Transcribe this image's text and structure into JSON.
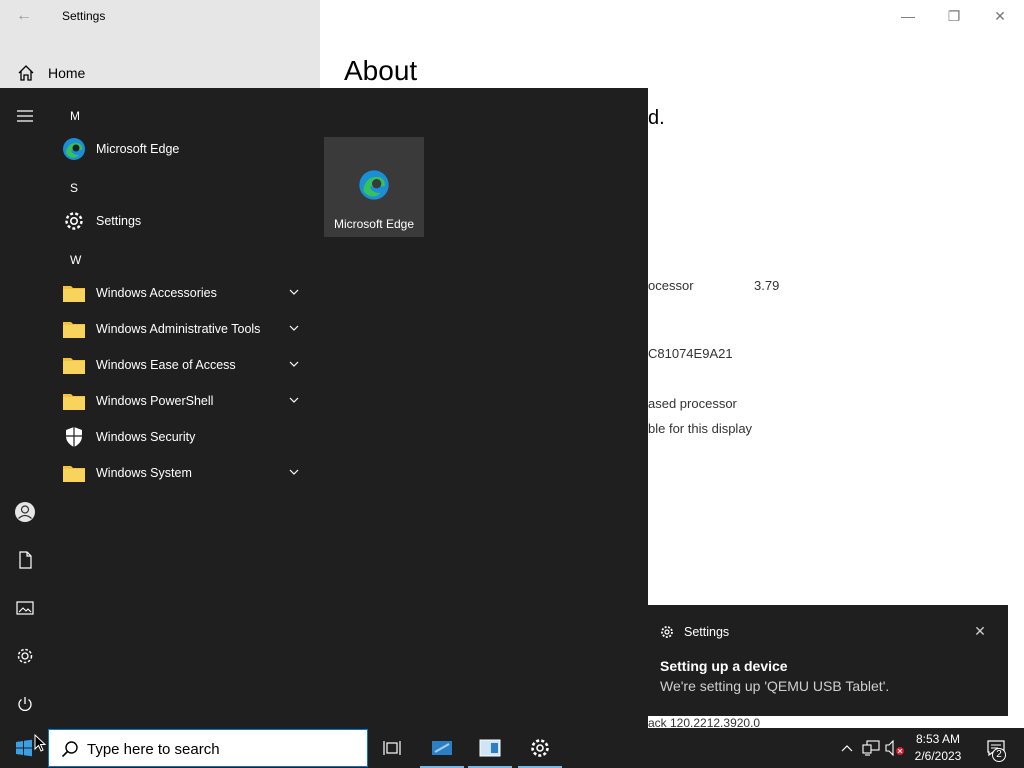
{
  "window": {
    "title": "Settings",
    "back_icon": "back-arrow-icon",
    "controls": [
      "minimize",
      "restore",
      "close"
    ],
    "home_label": "Home",
    "page_title": "About",
    "peek_texts": {
      "line1": "d.",
      "processor_label": "ocessor",
      "processor_value": "3.79",
      "product_id": "C81074E9A21",
      "system_type": "ased processor",
      "pen_touch": "ble for this display",
      "experience": "ack 120.2212.3920.0"
    }
  },
  "start_menu": {
    "groups": [
      {
        "letter": "M",
        "items": [
          {
            "label": "Microsoft Edge",
            "icon": "edge-icon",
            "expandable": false
          }
        ]
      },
      {
        "letter": "S",
        "items": [
          {
            "label": "Settings",
            "icon": "gear-icon",
            "expandable": false
          }
        ]
      },
      {
        "letter": "W",
        "items": [
          {
            "label": "Windows Accessories",
            "icon": "folder-icon",
            "expandable": true
          },
          {
            "label": "Windows Administrative Tools",
            "icon": "folder-icon",
            "expandable": true
          },
          {
            "label": "Windows Ease of Access",
            "icon": "folder-icon",
            "expandable": true
          },
          {
            "label": "Windows PowerShell",
            "icon": "folder-icon",
            "expandable": true
          },
          {
            "label": "Windows Security",
            "icon": "shield-icon",
            "expandable": false
          },
          {
            "label": "Windows System",
            "icon": "folder-icon",
            "expandable": true
          }
        ]
      }
    ],
    "tile": {
      "label": "Microsoft Edge",
      "icon": "edge-icon"
    },
    "rail": [
      "hamburger-icon",
      "user-icon",
      "document-icon",
      "pictures-icon",
      "settings-icon",
      "power-icon"
    ]
  },
  "toast": {
    "app": "Settings",
    "title": "Setting up a device",
    "body": "We're setting up 'QEMU USB Tablet'."
  },
  "taskbar": {
    "search_placeholder": "Type here to search",
    "time": "8:53 AM",
    "date": "2/6/2023",
    "notification_count": "2"
  },
  "colors": {
    "start_bg": "#1f1f1f",
    "sidebar_bg": "#e6e6e6",
    "accent": "#0078d7",
    "folder": "#f3c13a"
  }
}
